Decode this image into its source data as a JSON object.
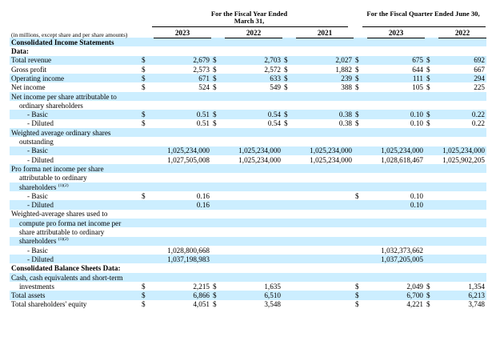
{
  "header": {
    "fiscal_year": "For the Fiscal Year Ended March 31,",
    "fiscal_quarter": "For the Fiscal Quarter Ended June 30,",
    "units_note": "(in millions, except share and per share amounts)",
    "years": [
      "2023",
      "2022",
      "2021",
      "2023",
      "2022"
    ]
  },
  "currency_symbol": "$",
  "rows": [
    {
      "label": "Consolidated Income Statements",
      "style": "bold"
    },
    {
      "label": "Data:",
      "style": "bold-indent"
    },
    {
      "label": "Total revenue",
      "style": "plain",
      "dollar": [
        true,
        true,
        true,
        true,
        true
      ],
      "values": [
        "2,679",
        "2,703",
        "2,027",
        "675",
        "692"
      ]
    },
    {
      "label": "Gross profit",
      "style": "plain",
      "dollar": [
        true,
        true,
        true,
        true,
        true
      ],
      "values": [
        "2,573",
        "2,572",
        "1,882",
        "644",
        "667"
      ]
    },
    {
      "label": "Operating income",
      "style": "plain",
      "dollar": [
        true,
        true,
        true,
        true,
        true
      ],
      "values": [
        "671",
        "633",
        "239",
        "111",
        "294"
      ]
    },
    {
      "label": "Net income",
      "style": "plain",
      "dollar": [
        true,
        true,
        true,
        true,
        true
      ],
      "values": [
        "524",
        "549",
        "388",
        "105",
        "225"
      ]
    },
    {
      "label": "Net income per share attributable to",
      "style": "plain"
    },
    {
      "label": "ordinary shareholders",
      "style": "cont"
    },
    {
      "label": "- Basic",
      "style": "ind",
      "dollar": [
        true,
        true,
        true,
        true,
        true
      ],
      "values": [
        "0.51",
        "0.54",
        "0.38",
        "0.10",
        "0.22"
      ]
    },
    {
      "label": "- Diluted",
      "style": "ind",
      "dollar": [
        true,
        true,
        true,
        true,
        true
      ],
      "values": [
        "0.51",
        "0.54",
        "0.38",
        "0.10",
        "0.22"
      ]
    },
    {
      "label": "Weighted average ordinary shares",
      "style": "plain"
    },
    {
      "label": "outstanding",
      "style": "cont"
    },
    {
      "label": "- Basic",
      "style": "ind",
      "dollar": [
        false,
        false,
        false,
        false,
        false
      ],
      "values": [
        "1,025,234,000",
        "1,025,234,000",
        "1,025,234,000",
        "1,025,234,000",
        "1,025,234,000"
      ]
    },
    {
      "label": "- Diluted",
      "style": "ind",
      "dollar": [
        false,
        false,
        false,
        false,
        false
      ],
      "values": [
        "1,027,505,008",
        "1,025,234,000",
        "1,025,234,000",
        "1,028,618,467",
        "1,025,902,205"
      ]
    },
    {
      "label": "Pro forma net income per share",
      "style": "plain"
    },
    {
      "label": "attributable to ordinary",
      "style": "cont"
    },
    {
      "label": "shareholders",
      "sup": "(1)(2)",
      "style": "cont"
    },
    {
      "label": "- Basic",
      "style": "ind",
      "dollar": [
        true,
        false,
        false,
        true,
        false
      ],
      "values": [
        "0.16",
        "",
        "",
        "0.10",
        ""
      ]
    },
    {
      "label": "- Diluted",
      "style": "ind",
      "dollar": [
        false,
        false,
        false,
        false,
        false
      ],
      "values": [
        "0.16",
        "",
        "",
        "0.10",
        ""
      ]
    },
    {
      "label": "Weighted-average shares used to",
      "style": "plain"
    },
    {
      "label": "compute pro forma net income per",
      "style": "cont"
    },
    {
      "label": "share attributable to ordinary",
      "style": "cont"
    },
    {
      "label": "shareholders",
      "sup": "(1)(2)",
      "style": "cont"
    },
    {
      "label": "- Basic",
      "style": "ind",
      "dollar": [
        false,
        false,
        false,
        false,
        false
      ],
      "values": [
        "1,028,800,668",
        "",
        "",
        "1,032,373,662",
        ""
      ]
    },
    {
      "label": "- Diluted",
      "style": "ind",
      "dollar": [
        false,
        false,
        false,
        false,
        false
      ],
      "values": [
        "1,037,198,983",
        "",
        "",
        "1,037,205,005",
        ""
      ]
    },
    {
      "label": "Consolidated Balance Sheets Data:",
      "style": "bold"
    },
    {
      "label": "Cash, cash equivalents and short-term",
      "style": "plain"
    },
    {
      "label": "investments",
      "style": "cont",
      "dollar": [
        true,
        true,
        false,
        true,
        true
      ],
      "values": [
        "2,215",
        "1,635",
        "",
        "2,049",
        "1,354"
      ]
    },
    {
      "label": "Total assets",
      "style": "plain",
      "dollar": [
        true,
        true,
        false,
        true,
        true
      ],
      "values": [
        "6,866",
        "6,510",
        "",
        "6,700",
        "6,213"
      ]
    },
    {
      "label": "Total shareholders' equity",
      "style": "plain",
      "dollar": [
        true,
        true,
        false,
        true,
        true
      ],
      "values": [
        "4,051",
        "3,548",
        "",
        "4,221",
        "3,748"
      ]
    }
  ]
}
